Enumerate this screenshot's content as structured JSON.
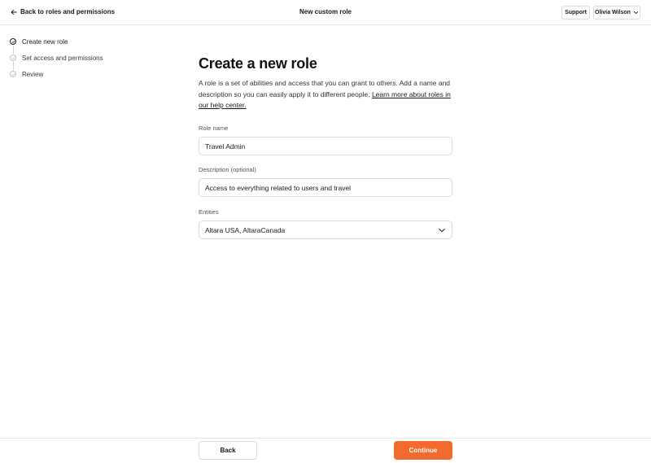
{
  "header": {
    "back_label": "Back to roles and permissions",
    "title": "New custom role",
    "support_label": "Support",
    "user_name": "Olivia Wilson"
  },
  "stepper": {
    "steps": [
      {
        "label": "Create new role",
        "state": "active"
      },
      {
        "label": "Set access and permissions",
        "state": "pending"
      },
      {
        "label": "Review",
        "state": "pending"
      }
    ]
  },
  "form": {
    "heading": "Create a new role",
    "intro_text": "A role is a set of abilities and access that you can grant to others. Add a name and description so you can easily apply it to different people. ",
    "intro_link": "Learn more about roles in our help center.",
    "role_name": {
      "label": "Role name",
      "value": "Travel Admin"
    },
    "description": {
      "label": "Description (optional)",
      "value": "Access to everything related to users and travel"
    },
    "entities": {
      "label": "Entities",
      "value": "Altara USA, AltaraCanada"
    }
  },
  "footer": {
    "back_label": "Back",
    "continue_label": "Continue"
  },
  "colors": {
    "accent": "#f26a2e",
    "border": "#dadada",
    "text": "#1a1a1a"
  },
  "icons": {
    "back": "arrow-left-icon",
    "user_menu": "chevron-down-icon",
    "step": "check-circle-icon",
    "select": "chevron-down-icon"
  }
}
